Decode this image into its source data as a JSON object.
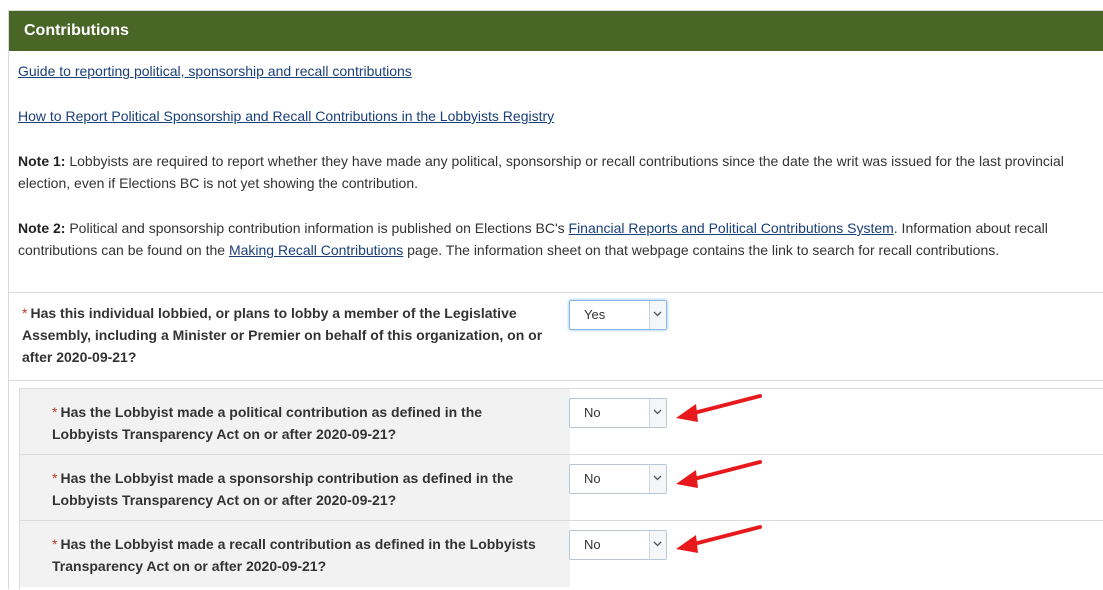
{
  "section": {
    "title": "Contributions"
  },
  "links": {
    "guide": "Guide to reporting political, sponsorship and recall contributions",
    "how_to": "How to Report Political Sponsorship and Recall Contributions in the Lobbyists Registry"
  },
  "notes": {
    "note1_label": "Note 1:",
    "note1_text": "Lobbyists are required to report whether they have made any political, sponsorship or recall contributions since the date the writ was issued for the last provincial election, even if Elections BC is not yet showing the contribution.",
    "note2_label": "Note 2:",
    "note2_text_a": "Political and sponsorship contribution information is published on Elections BC's",
    "note2_link_a": "Financial Reports and Political Contributions System",
    "note2_text_b": ". Information about recall contributions can be found on the",
    "note2_link_b": "Making Recall Contributions",
    "note2_text_c": "page. The information sheet on that webpage contains the link to search for recall contributions."
  },
  "questions": {
    "required_marker": "*",
    "main": {
      "label": "Has this individual lobbied, or plans to lobby a member of the Legislative Assembly, including a Minister or Premier on behalf of this organization, on or after 2020-09-21?",
      "value": "Yes"
    },
    "sub": [
      {
        "label": "Has the Lobbyist made a political contribution as defined in the Lobbyists Transparency Act on or after 2020-09-21?",
        "value": "No"
      },
      {
        "label": "Has the Lobbyist made a sponsorship contribution as defined in the Lobbyists Transparency Act on or after 2020-09-21?",
        "value": "No"
      },
      {
        "label": "Has the Lobbyist made a recall contribution as defined in the Lobbyists Transparency Act on or after 2020-09-21?",
        "value": "No"
      }
    ]
  },
  "colors": {
    "header_bg": "#4a6627",
    "link": "#1a3f7a",
    "required": "#c0392b",
    "annotation_arrow": "#e8191c"
  },
  "icons": {
    "dropdown": "chevron-down-icon",
    "annotation": "red-arrow-icon"
  }
}
